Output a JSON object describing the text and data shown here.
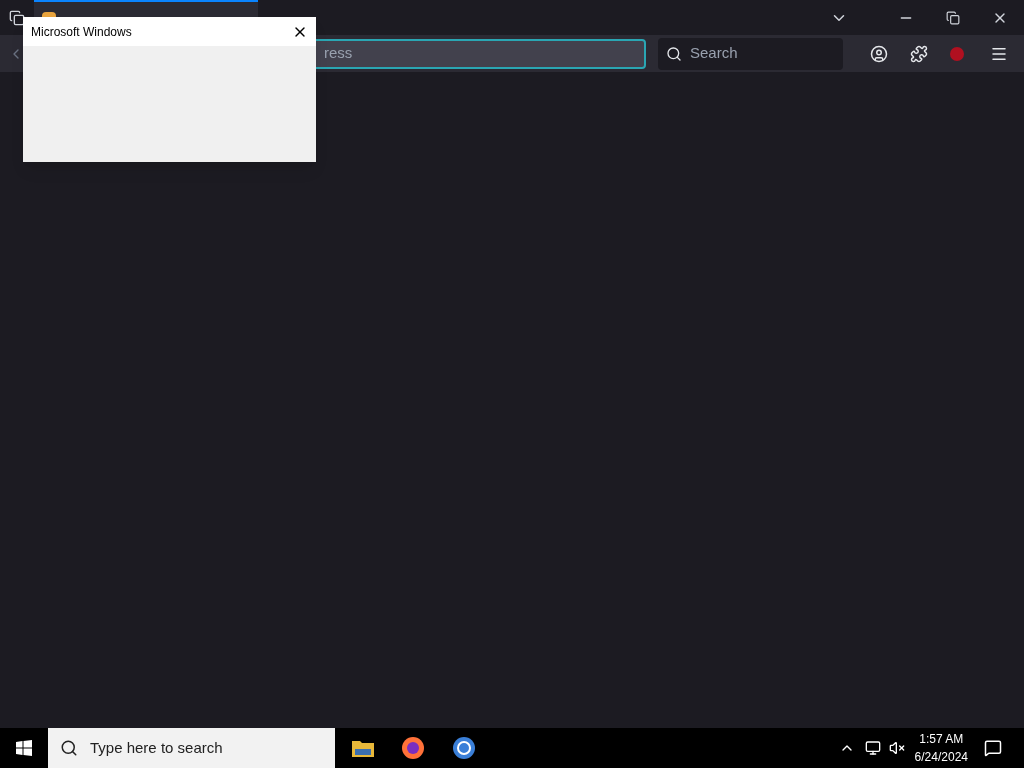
{
  "dialog": {
    "title": "Microsoft Windows"
  },
  "browser": {
    "address_text": "ress",
    "search_placeholder": "Search"
  },
  "taskbar": {
    "search_placeholder": "Type here to search",
    "time": "1:57 AM",
    "date": "6/24/2024"
  }
}
